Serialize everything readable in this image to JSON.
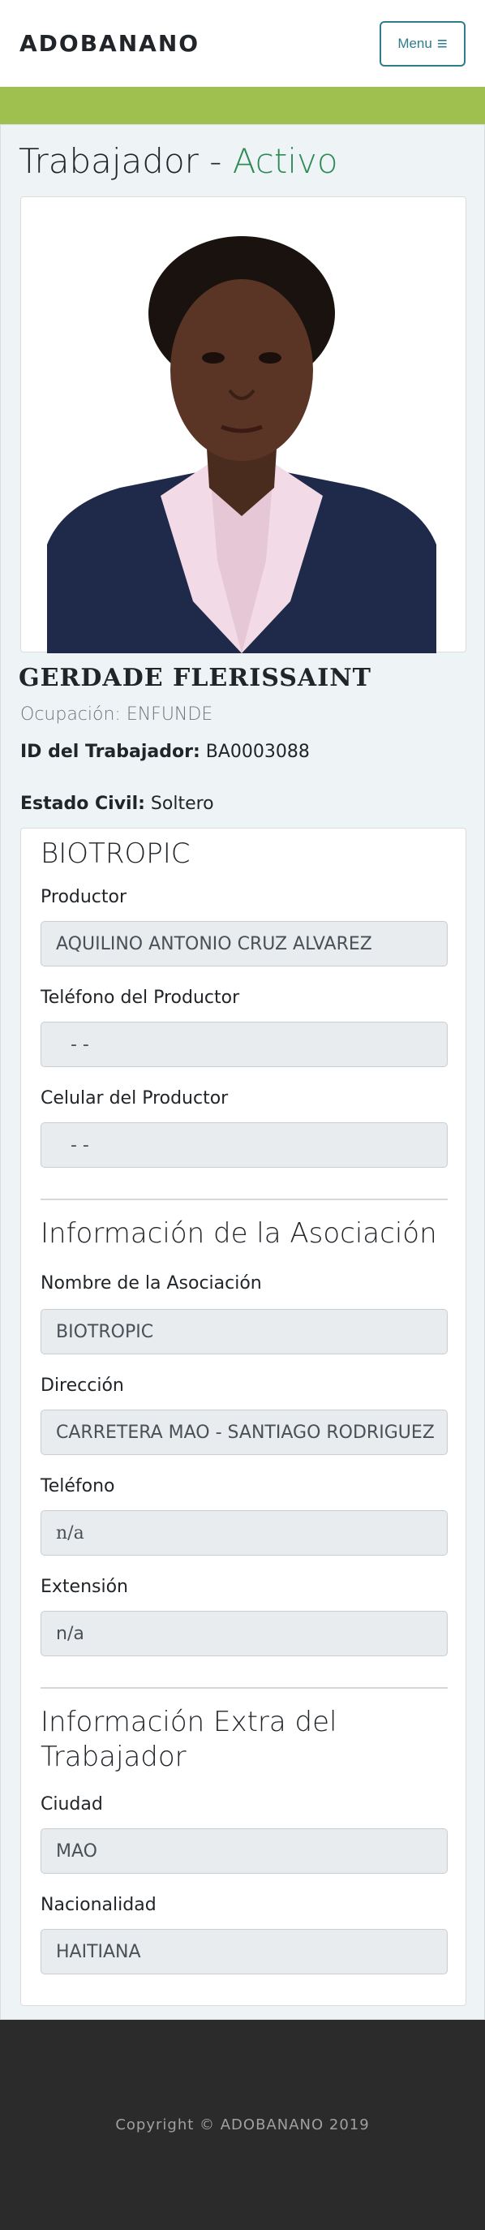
{
  "navbar": {
    "brand": "ADOBANANO",
    "menu_label": "Menu"
  },
  "page": {
    "title": "Trabajador - ",
    "status": "Activo"
  },
  "worker": {
    "name": "GERDADE FLERISSAINT",
    "occupation": "Ocupación: ENFUNDE",
    "id_label": "ID del Trabajador:",
    "id_value": "BA0003088",
    "marital_label": "Estado Civil:",
    "marital_value": "Soltero"
  },
  "producer_section": {
    "heading": "BIOTROPIC",
    "producer_label": "Productor",
    "producer_value": "AQUILINO ANTONIO  CRUZ ALVAREZ",
    "phone_label": "Teléfono del Productor",
    "phone_value": "-  -",
    "cell_label": "Celular del Productor",
    "cell_value": "-  -"
  },
  "association": {
    "heading": "Información de la Asociación",
    "name_label": "Nombre de la Asociación",
    "name_value": "BIOTROPIC",
    "address_label": "Dirección",
    "address_value": "CARRETERA MAO - SANTIAGO RODRIGUEZ",
    "phone_label": "Teléfono",
    "phone_value": "n/a",
    "ext_label": "Extensión",
    "ext_value": "n/a"
  },
  "extra": {
    "heading_line1": "Información Extra del",
    "heading_line2": "Trabajador",
    "city_label": "Ciudad",
    "city_value": "MAO",
    "nationality_label": "Nacionalidad",
    "nationality_value": "HAITIANA"
  },
  "footer": {
    "copyright": "Copyright © ADOBANANO 2019"
  },
  "colors": {
    "accent": "#9fc04f",
    "status": "#2e8b57",
    "button": "#2f7d8b",
    "footer": "#2b2b2b"
  },
  "icons": {
    "menu": "hamburger-icon"
  }
}
